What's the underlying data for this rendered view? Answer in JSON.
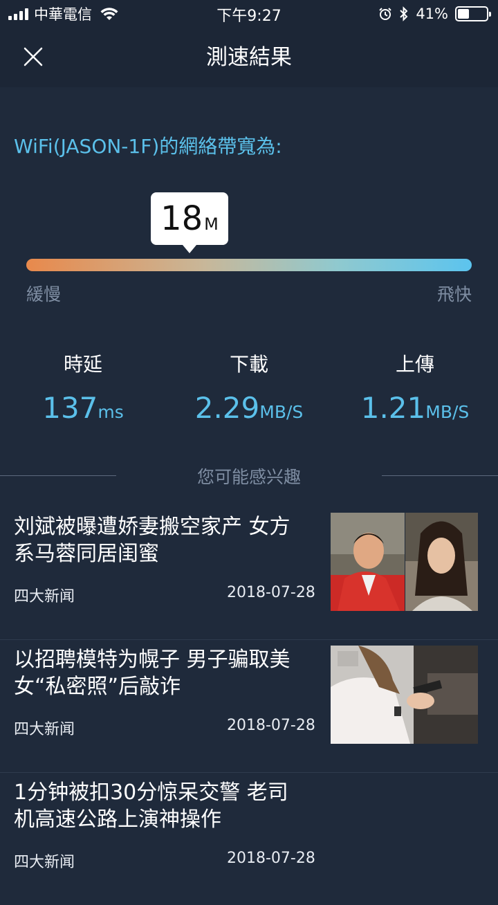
{
  "status": {
    "carrier": "中華電信",
    "time": "下午9:27",
    "battery": "41%",
    "battery_level": 0.41
  },
  "header": {
    "title": "測速結果"
  },
  "speed": {
    "network_label": "WiFi(JASON-1F)的網絡帶寬為:",
    "value": "18",
    "unit": "M",
    "slow_label": "緩慢",
    "fast_label": "飛快"
  },
  "metrics": [
    {
      "name": "時延",
      "value": "137",
      "unit": "ms"
    },
    {
      "name": "下載",
      "value": "2.29",
      "unit": "MB/S"
    },
    {
      "name": "上傳",
      "value": "1.21",
      "unit": "MB/S"
    }
  ],
  "recommend": {
    "heading": "您可能感兴趣"
  },
  "news": [
    {
      "title": "刘斌被曝遭娇妻搬空家产 女方系马蓉同居闺蜜",
      "source": "四大新闻",
      "date": "2018-07-28"
    },
    {
      "title": "以招聘模特为幌子 男子骗取美女“私密照”后敲诈",
      "source": "四大新闻",
      "date": "2018-07-28"
    },
    {
      "title": "1分钟被扣30分惊呆交警 老司机高速公路上演神操作",
      "source": "四大新闻",
      "date": "2018-07-28"
    }
  ],
  "colors": {
    "background": "#1f2a3b",
    "accent": "#5bc0ea",
    "bar_start": "#e8894c",
    "bar_end": "#5cc4ee"
  }
}
